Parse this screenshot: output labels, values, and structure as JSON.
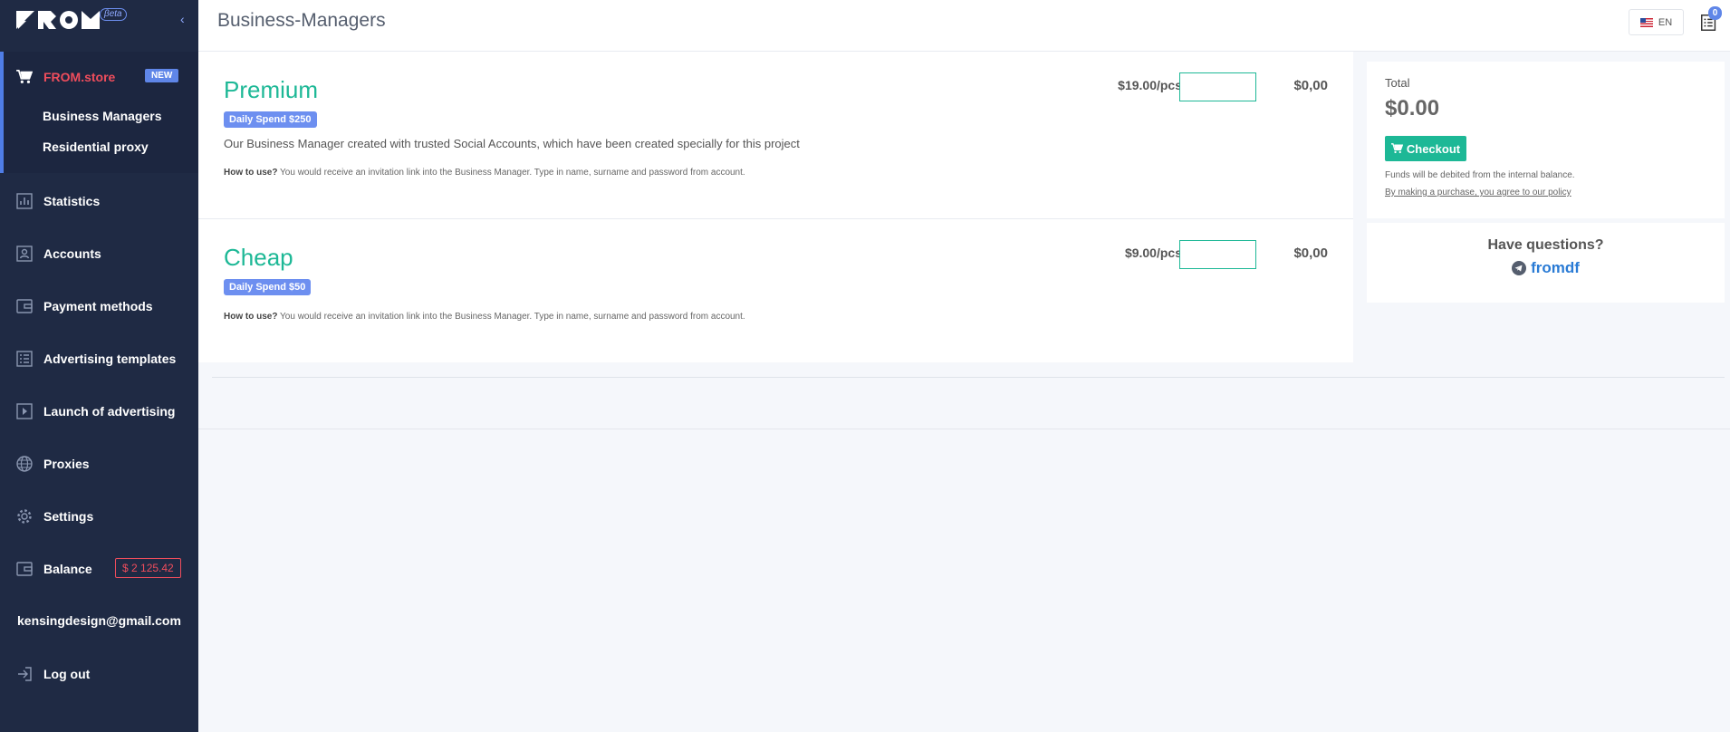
{
  "brand": {
    "logo_text": "FROM",
    "beta": "βeta"
  },
  "sidebar": {
    "store": {
      "label": "FROM.store",
      "badge": "NEW"
    },
    "store_sub": [
      {
        "label": "Business Managers"
      },
      {
        "label": "Residential proxy"
      }
    ],
    "items": [
      {
        "label": "Statistics",
        "icon": "bar-chart-icon"
      },
      {
        "label": "Accounts",
        "icon": "user-card-icon"
      },
      {
        "label": "Payment methods",
        "icon": "wallet-icon"
      },
      {
        "label": "Advertising templates",
        "icon": "list-icon"
      },
      {
        "label": "Launch of advertising",
        "icon": "play-icon"
      },
      {
        "label": "Proxies",
        "icon": "globe-icon"
      },
      {
        "label": "Settings",
        "icon": "gear-icon"
      },
      {
        "label": "Balance",
        "icon": "wallet-icon"
      }
    ],
    "balance": "$  2 125.42",
    "email": "kensingdesign@gmail.com",
    "logout": "Log out"
  },
  "header": {
    "title": "Business-Managers",
    "lang": "EN",
    "cart_count": "0"
  },
  "products": [
    {
      "name": "Premium",
      "badge": "Daily Spend $250",
      "description": "Our Business Manager created with trusted Social Accounts, which have been created specially for this project",
      "howto_label": "How to use?",
      "howto_text": " You would receive an invitation link into the Business Manager. Type in name, surname and password from account.",
      "price": "$19.00/pcs",
      "qty": "",
      "total": "$0,00"
    },
    {
      "name": "Cheap",
      "badge": "Daily Spend $50",
      "description": "",
      "howto_label": "How to use?",
      "howto_text": " You would receive an invitation link into the Business Manager. Type in name, surname and password from account.",
      "price": "$9.00/pcs",
      "qty": "",
      "total": "$0,00"
    }
  ],
  "summary": {
    "total_label": "Total",
    "total_value": "$0.00",
    "checkout": "Checkout",
    "funds_note": "Funds will be debited from the internal balance.",
    "policy": "By making a purchase, you agree to our policy",
    "questions": "Have questions?",
    "telegram": "fromdf"
  },
  "colors": {
    "accent": "#1db896",
    "sidebar": "#1f2a44",
    "brand_red": "#ef4d5c",
    "badge_blue": "#6d8ff0"
  }
}
